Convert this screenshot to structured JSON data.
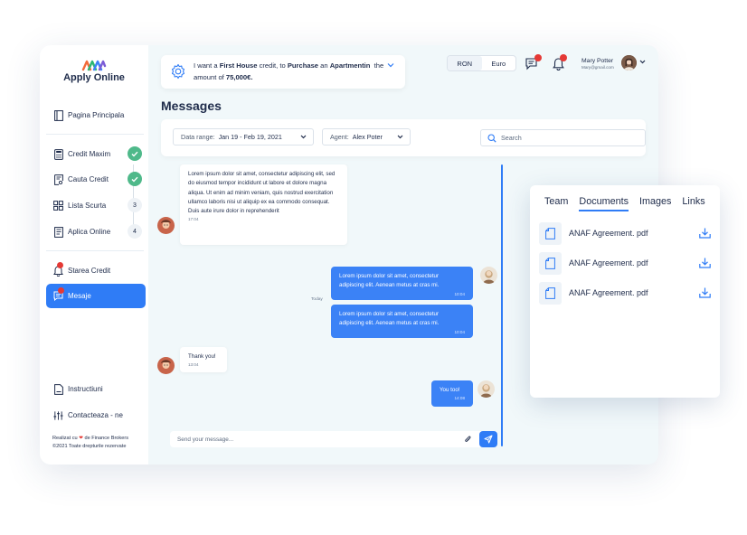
{
  "sidebar": {
    "brand": "Apply Online",
    "home": "Pagina Principala",
    "steps": [
      {
        "label": "Credit Maxim",
        "state": "done",
        "icon": "calculator-icon"
      },
      {
        "label": "Cauta Credit",
        "state": "done",
        "icon": "search-doc-icon"
      },
      {
        "label": "Lista Scurta",
        "state": "3",
        "icon": "grid-icon"
      },
      {
        "label": "Aplica Online",
        "state": "4",
        "icon": "doc-icon"
      }
    ],
    "status": "Starea Credit",
    "messages": "Mesaje",
    "instructions": "Instructiuni",
    "contact": "Contacteaza - ne",
    "footer_line1_a": "Realizat cu",
    "footer_line1_b": "de Finance Brokers",
    "footer_line2": "©2021 Toate drepturile rezervate"
  },
  "banner": {
    "t1": "I want a ",
    "b1": "First House",
    "t2": " credit, to ",
    "b2": "Purchase",
    "t3": " an ",
    "b3": "Apartmentin",
    "t4": "  the",
    "t5": "amount of ",
    "b4": "75,000€."
  },
  "currency": {
    "options": [
      "RON",
      "Euro"
    ],
    "selected": "RON"
  },
  "user": {
    "name": "Mary Potter",
    "email": "Mary@gmail.com"
  },
  "page_title": "Messages",
  "filters": {
    "date_label": "Data range:",
    "date_value": "Jan 19 - Feb 19, 2021",
    "agent_label": "Agent:",
    "agent_value": "Alex Poter",
    "search_placeholder": "Search"
  },
  "chat": {
    "messages": [
      {
        "dir": "in",
        "text": "Lorem ipsum dolor sit amet, consectetur adipiscing elit, sed do eiusmod tempor incididunt ut labore et dolore magna aliqua. Ut enim ad minim veniam, quis nostrud exercitation ullamco laboris nisi ut aliquip ex ea commodo consequat. Duis aute irure dolor in reprehenderit",
        "time": "17:04"
      },
      {
        "dir": "out",
        "text": "Lorem ipsum dolor sit amet, consectetur adipiscing elit. Aenean metus at cras mi.",
        "time": "10:04"
      },
      {
        "dir": "out",
        "text": "Lorem ipsum dolor sit amet, consectetur adipiscing elit. Aenean metus at cras mi.",
        "time": "10:04"
      },
      {
        "dir": "in",
        "text": "Thank you!",
        "time": "13:04"
      },
      {
        "dir": "out",
        "text": "You too!",
        "time": "14:08"
      }
    ],
    "divider": "Today",
    "composer_placeholder": "Send your message..."
  },
  "documents": {
    "tabs": [
      "Team",
      "Documents",
      "Images",
      "Links"
    ],
    "active_tab": "Documents",
    "files": [
      "ANAF Agreement. pdf",
      "ANAF Agreement. pdf",
      "ANAF Agreement. pdf"
    ]
  },
  "colors": {
    "accent": "#2f7cf6",
    "success": "#4fb98a",
    "alert": "#e53935",
    "background": "#f1f8fa"
  }
}
